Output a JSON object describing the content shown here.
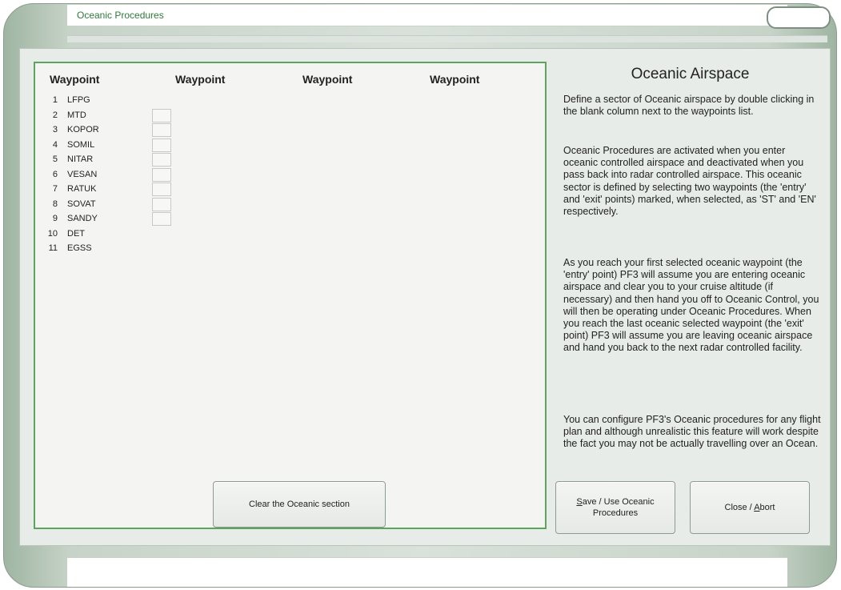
{
  "window": {
    "title": "Oceanic Procedures"
  },
  "waypoints_panel": {
    "column_headers": [
      "Waypoint",
      "Waypoint",
      "Waypoint",
      "Waypoint"
    ],
    "waypoints": [
      {
        "num": "1",
        "name": "LFPG",
        "slot": false
      },
      {
        "num": "2",
        "name": "MTD",
        "slot": true
      },
      {
        "num": "3",
        "name": "KOPOR",
        "slot": true
      },
      {
        "num": "4",
        "name": "SOMIL",
        "slot": true
      },
      {
        "num": "5",
        "name": "NITAR",
        "slot": true
      },
      {
        "num": "6",
        "name": "VESAN",
        "slot": true
      },
      {
        "num": "7",
        "name": "RATUK",
        "slot": true
      },
      {
        "num": "8",
        "name": "SOVAT",
        "slot": true
      },
      {
        "num": "9",
        "name": "SANDY",
        "slot": true
      },
      {
        "num": "10",
        "name": "DET",
        "slot": false
      },
      {
        "num": "11",
        "name": "EGSS",
        "slot": false
      }
    ],
    "clear_button": "Clear the Oceanic section"
  },
  "info": {
    "title": "Oceanic Airspace",
    "paragraphs": [
      "Define a sector of Oceanic airspace by double clicking in the blank column next to the waypoints list.",
      "Oceanic Procedures are activated when you enter oceanic controlled airspace and deactivated when you pass back into radar controlled airspace. This oceanic sector is defined by selecting two waypoints (the 'entry' and 'exit' points) marked, when selected, as 'ST' and 'EN' respectively.",
      "As you reach your first selected oceanic waypoint (the 'entry' point) PF3 will assume you are entering oceanic airspace and clear you to your cruise altitude (if necessary) and then hand you off to Oceanic Control, you will then be operating under Oceanic Procedures. When you reach the last oceanic selected waypoint (the 'exit' point) PF3 will assume you are leaving oceanic airspace and hand you back to the next radar controlled facility.",
      "You can configure PF3's Oceanic procedures for any flight plan and although unrealistic this feature will work despite the fact you may not be actually travelling over an Ocean."
    ]
  },
  "buttons": {
    "save_key": "S",
    "save_rest_line1": "ave / Use Oceanic",
    "save_line2": "Procedures",
    "close_prefix": "Close / ",
    "close_key": "A",
    "close_rest": "bort"
  }
}
